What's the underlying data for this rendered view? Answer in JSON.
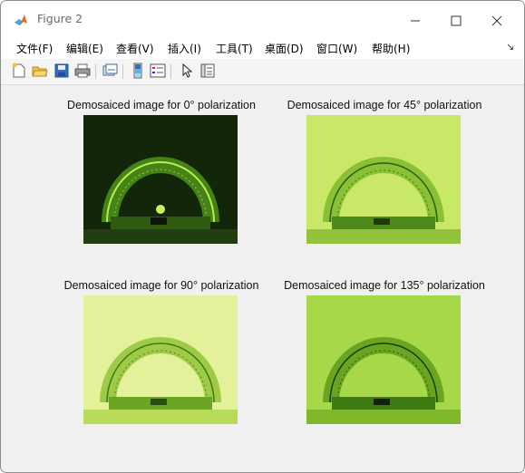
{
  "window": {
    "title": "Figure 2"
  },
  "menu": [
    "文件(F)",
    "编辑(E)",
    "查看(V)",
    "插入(I)",
    "工具(T)",
    "桌面(D)",
    "窗口(W)",
    "帮助(H)"
  ],
  "toolbar": {
    "buttons": [
      "new-figure-icon",
      "open-file-icon",
      "save-icon",
      "print-icon",
      "link-plot-icon",
      "insert-colorbar-icon",
      "insert-legend-icon",
      "edit-plot-arrow-icon",
      "property-inspector-icon"
    ]
  },
  "subplots": [
    {
      "title": "Demosaiced image for 0° polarization",
      "bg": "#14260a",
      "tint": "#3e7a12"
    },
    {
      "title": "Demosaiced image for 45° polarization",
      "bg": "#c9e868",
      "tint": "#7fb82a"
    },
    {
      "title": "Demosaiced image for 90° polarization",
      "bg": "#e2f19a",
      "tint": "#93c33a"
    },
    {
      "title": "Demosaiced image for 135° polarization",
      "bg": "#a6d84a",
      "tint": "#5f9c1a"
    }
  ],
  "colors": {
    "window_bg": "#f0f0f0",
    "titlebar_bg": "#ffffff",
    "accent": "#0072bd"
  }
}
